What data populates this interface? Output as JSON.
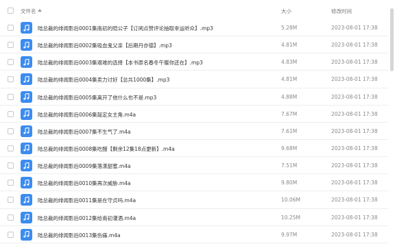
{
  "header": {
    "name_label": "文件名",
    "size_label": "大小",
    "time_label": "修改时间"
  },
  "colors": {
    "file_icon": "#3b8cf0"
  },
  "files": [
    {
      "name": "陆总裁的绯闻影后0001集南初的陪公子【订阅点赞评论抽取幸运听众】.mp3",
      "size": "5.28M",
      "time": "2023-08-01 17:38"
    },
    {
      "name": "陆总裁的绯闻影后0002集吸血鬼父亲【后期丹亦德】.mp3",
      "size": "4.81M",
      "time": "2023-08-01 17:38"
    },
    {
      "name": "陆总裁的绯闻影后0003集艰难的选择【本书原名春冬午暖你还在】.mp3",
      "size": "4.83M",
      "time": "2023-08-01 17:38"
    },
    {
      "name": "陆总裁的绯闻影后0004集卖力讨好【总共1000集】.mp3",
      "size": "4.81M",
      "time": "2023-08-01 17:38"
    },
    {
      "name": "陆总裁的绯闻影后0005集离开了他什么也不是.mp3",
      "size": "4.88M",
      "time": "2023-08-01 17:38"
    },
    {
      "name": "陆总裁的绯闻影后0006集敲定女主角.m4a",
      "size": "7.67M",
      "time": "2023-08-01 17:38"
    },
    {
      "name": "陆总裁的绯闻影后0007集不生气了.m4a",
      "size": "7.61M",
      "time": "2023-08-01 17:38"
    },
    {
      "name": "陆总裁的绯闻影后0008集吃醋【剩余12集18点更新】.m4a",
      "size": "9.68M",
      "time": "2023-08-01 17:38"
    },
    {
      "name": "陆总裁的绯闻影后0009集落漾甜蜜.m4a",
      "size": "7.51M",
      "time": "2023-08-01 17:38"
    },
    {
      "name": "陆总裁的绯闻影后0010集再次威胁.m4a",
      "size": "9.80M",
      "time": "2023-08-01 17:38"
    },
    {
      "name": "陆总裁的绯闻影后0011集是在守贞吗.m4a",
      "size": "10.06M",
      "time": "2023-08-01 17:38"
    },
    {
      "name": "陆总裁的绯闻影后0012集给南初灌酒.m4a",
      "size": "10.25M",
      "time": "2023-08-01 17:38"
    },
    {
      "name": "陆总裁的绯闻影后0013集伤痛.m4a",
      "size": "9.97M",
      "time": "2023-08-01 17:38"
    }
  ]
}
